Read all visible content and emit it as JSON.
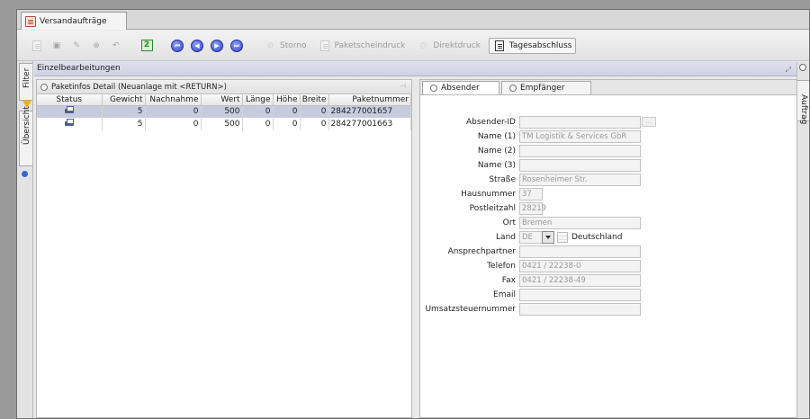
{
  "window": {
    "tab_title": "Versandaufträge"
  },
  "toolbar": {
    "storno": "Storno",
    "paketscheindruck": "Paketscheindruck",
    "direktdruck": "Direktdruck",
    "tagesabschluss": "Tagesabschluss"
  },
  "side_tabs": {
    "filter": "Filter",
    "uebersicht": "Übersicht",
    "auftrag": "Auftrag"
  },
  "section": {
    "title": "Einzelbearbeitungen"
  },
  "paket_panel": {
    "title": "Paketinfos Detail (Neuanlage mit <RETURN>)",
    "columns": [
      "Status",
      "Gewicht",
      "Nachnahme",
      "Wert",
      "Länge",
      "Höhe",
      "Breite",
      "Paketnummer"
    ],
    "rows": [
      {
        "gewicht": "5",
        "nachnahme": "0",
        "wert": "500",
        "laenge": "0",
        "hoehe": "0",
        "breite": "0",
        "paketnummer": "284277001657"
      },
      {
        "gewicht": "5",
        "nachnahme": "0",
        "wert": "500",
        "laenge": "0",
        "hoehe": "0",
        "breite": "0",
        "paketnummer": "284277001663"
      }
    ]
  },
  "address_panel": {
    "tabs": [
      "Absender",
      "Empfänger"
    ],
    "fields": {
      "absender_id": {
        "label": "Absender-ID",
        "value": ""
      },
      "name1": {
        "label": "Name (1)",
        "value": "TM Logistik & Services GbR"
      },
      "name2": {
        "label": "Name (2)",
        "value": ""
      },
      "name3": {
        "label": "Name (3)",
        "value": ""
      },
      "strasse": {
        "label": "Straße",
        "value": "Rosenheimer Str."
      },
      "hausnummer": {
        "label": "Hausnummer",
        "value": "37"
      },
      "postleitzahl": {
        "label": "Postleitzahl",
        "value": "28219"
      },
      "ort": {
        "label": "Ort",
        "value": "Bremen"
      },
      "land": {
        "label": "Land",
        "code": "DE",
        "name": "Deutschland"
      },
      "ansprechpartner": {
        "label": "Ansprechpartner",
        "value": ""
      },
      "telefon": {
        "label": "Telefon",
        "value": "0421 / 22238-0"
      },
      "fax": {
        "label": "Fax",
        "value": "0421 / 22238-49"
      },
      "email": {
        "label": "Email",
        "value": ""
      },
      "ust": {
        "label": "Umsatzsteuernummer",
        "value": ""
      }
    }
  }
}
